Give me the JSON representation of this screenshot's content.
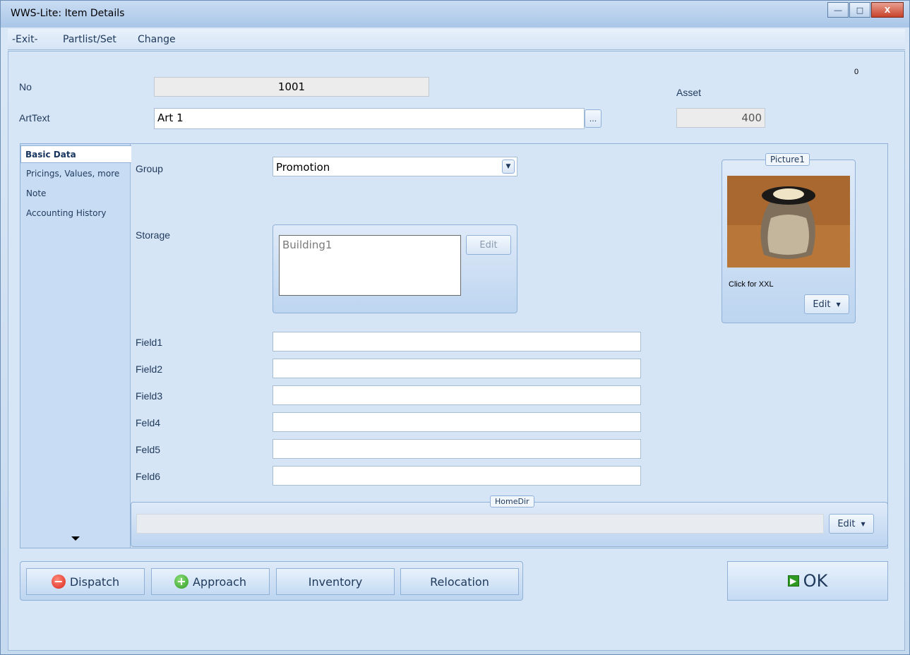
{
  "window": {
    "title": "WWS-Lite: Item Details"
  },
  "menu": {
    "items": [
      "-Exit-",
      "Partlist/Set",
      "Change"
    ]
  },
  "header": {
    "counter": "0",
    "no_label": "No",
    "no_value": "1001",
    "arttext_label": "ArtText",
    "arttext_value": "Art 1",
    "arttext_button": "...",
    "asset_label": "Asset",
    "asset_value": "400"
  },
  "tabs": [
    "Basic Data",
    "Pricings, Values, more",
    "Note",
    "Accounting History"
  ],
  "basic": {
    "group_label": "Group",
    "group_value": "Promotion",
    "storage_label": "Storage",
    "storage_items": [
      "Building1"
    ],
    "storage_edit": "Edit",
    "fields": [
      {
        "label": "Field1",
        "value": ""
      },
      {
        "label": "Field2",
        "value": ""
      },
      {
        "label": "Field3",
        "value": ""
      },
      {
        "label": "Feld4",
        "value": ""
      },
      {
        "label": "Feld5",
        "value": ""
      },
      {
        "label": "Feld6",
        "value": ""
      }
    ]
  },
  "picture": {
    "title": "Picture1",
    "caption": "Click for XXL",
    "edit": "Edit"
  },
  "homedir": {
    "title": "HomeDir",
    "value": "",
    "edit": "Edit"
  },
  "actions": {
    "dispatch": "Dispatch",
    "approach": "Approach",
    "inventory": "Inventory",
    "relocation": "Relocation",
    "ok": "OK"
  },
  "colors": {
    "accent": "#1e395b",
    "panel": "#d6e5f5",
    "border": "#8fb1d8"
  }
}
